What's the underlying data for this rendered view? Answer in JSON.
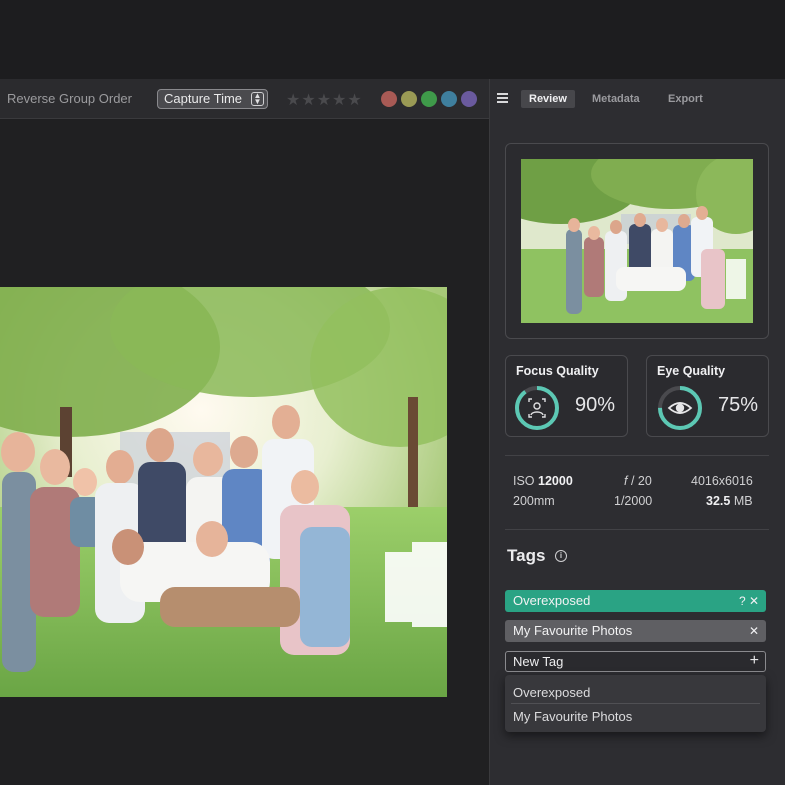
{
  "toolbar": {
    "reverse_label": "Reverse Group Order",
    "sort_value": "Capture Time",
    "stars": "★★★★★",
    "color_labels": [
      "#a85a55",
      "#9a9a55",
      "#3f9a4a",
      "#3f7f9e",
      "#6a5a9e"
    ]
  },
  "panel": {
    "tabs": [
      "Review",
      "Metadata",
      "Export"
    ],
    "active_tab": "Review"
  },
  "quality": {
    "focus": {
      "title": "Focus Quality",
      "value": "90%",
      "fraction": 0.9
    },
    "eye": {
      "title": "Eye Quality",
      "value": "75%",
      "fraction": 0.75
    }
  },
  "metadata": {
    "iso_label": "ISO",
    "iso_value": "12000",
    "aperture_f": "f",
    "aperture_value": "/ 20",
    "dimensions": "4016x6016",
    "focal": "200mm",
    "shutter": "1/2000",
    "size_value": "32.5",
    "size_unit": "MB"
  },
  "tags": {
    "header": "Tags",
    "applied": [
      {
        "label": "Overexposed",
        "controls": "? ✕",
        "color": "#2aa384"
      },
      {
        "label": "My Favourite Photos",
        "controls": "✕",
        "color": "#5f5f63"
      }
    ],
    "new_tag_value": "New Tag",
    "suggestions": [
      "Overexposed",
      "My Favourite Photos"
    ]
  },
  "colors": {
    "accent": "#2aa384",
    "ring": "#5cc8b4"
  }
}
